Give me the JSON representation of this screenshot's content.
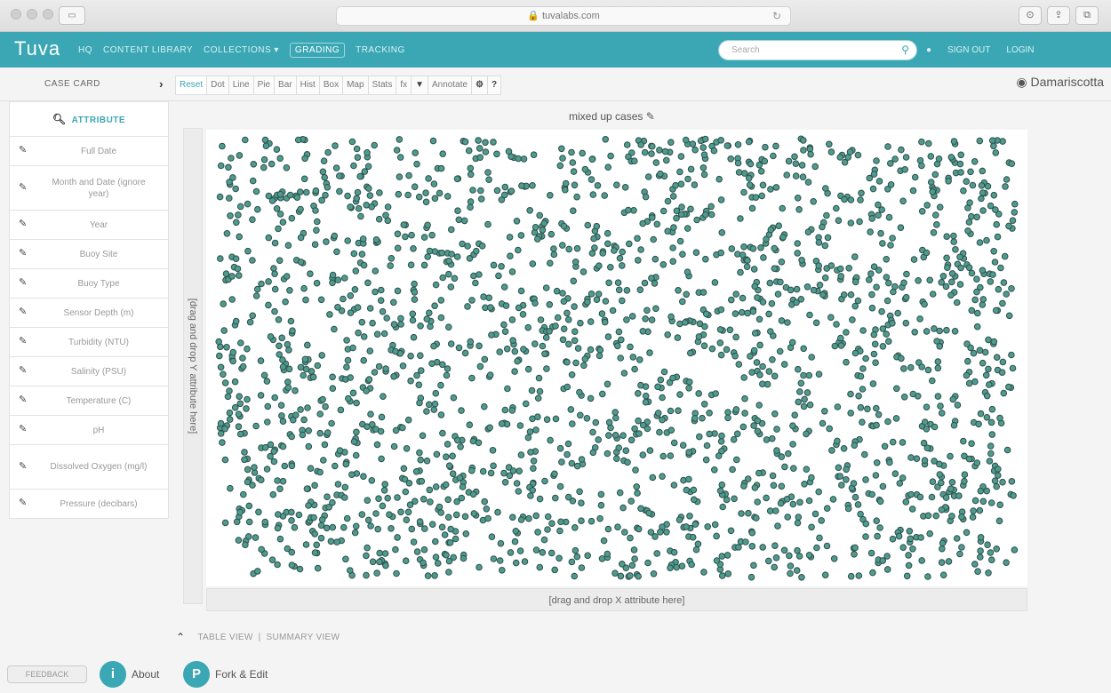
{
  "browser": {
    "url": "tuvalabs.com"
  },
  "nav": {
    "logo": "Tuva",
    "menu": [
      "HQ",
      "CONTENT LIBRARY",
      "COLLECTIONS ▾",
      "GRADING",
      "TRACKING"
    ],
    "active_index": 3,
    "search_placeholder": "Search",
    "right": [
      "SIGN OUT",
      "LOGIN"
    ]
  },
  "toolbar": {
    "case_card": "CASE CARD",
    "tools": [
      "Reset",
      "Dot",
      "Line",
      "Pie",
      "Bar",
      "Hist",
      "Box",
      "Map",
      "Stats",
      "fx",
      "▼",
      "Annotate",
      "⚙",
      "?"
    ],
    "selected": 0,
    "location": "Damariscotta"
  },
  "sidebar": {
    "header": "ATTRIBUTE",
    "attributes": [
      "Full Date",
      "Month and Date (ignore year)",
      "Year",
      "Buoy Site",
      "Buoy Type",
      "Sensor Depth (m)",
      "Turbidity (NTU)",
      "Salinity (PSU)",
      "Temperature (C)",
      "pH",
      "Dissolved Oxygen (mg/l)",
      "Pressure (decibars)"
    ]
  },
  "plot": {
    "title": "mixed up cases",
    "y_drop": "[drag and drop Y attribute here]",
    "x_drop": "[drag and drop X attribute here]",
    "point_color": "#4f9b8f",
    "point_stroke": "#2f4f4a"
  },
  "bottom_tabs": [
    "TABLE VIEW",
    "SUMMARY VIEW"
  ],
  "footer": {
    "feedback": "FEEDBACK",
    "about": "About",
    "fork": "Fork & Edit"
  }
}
